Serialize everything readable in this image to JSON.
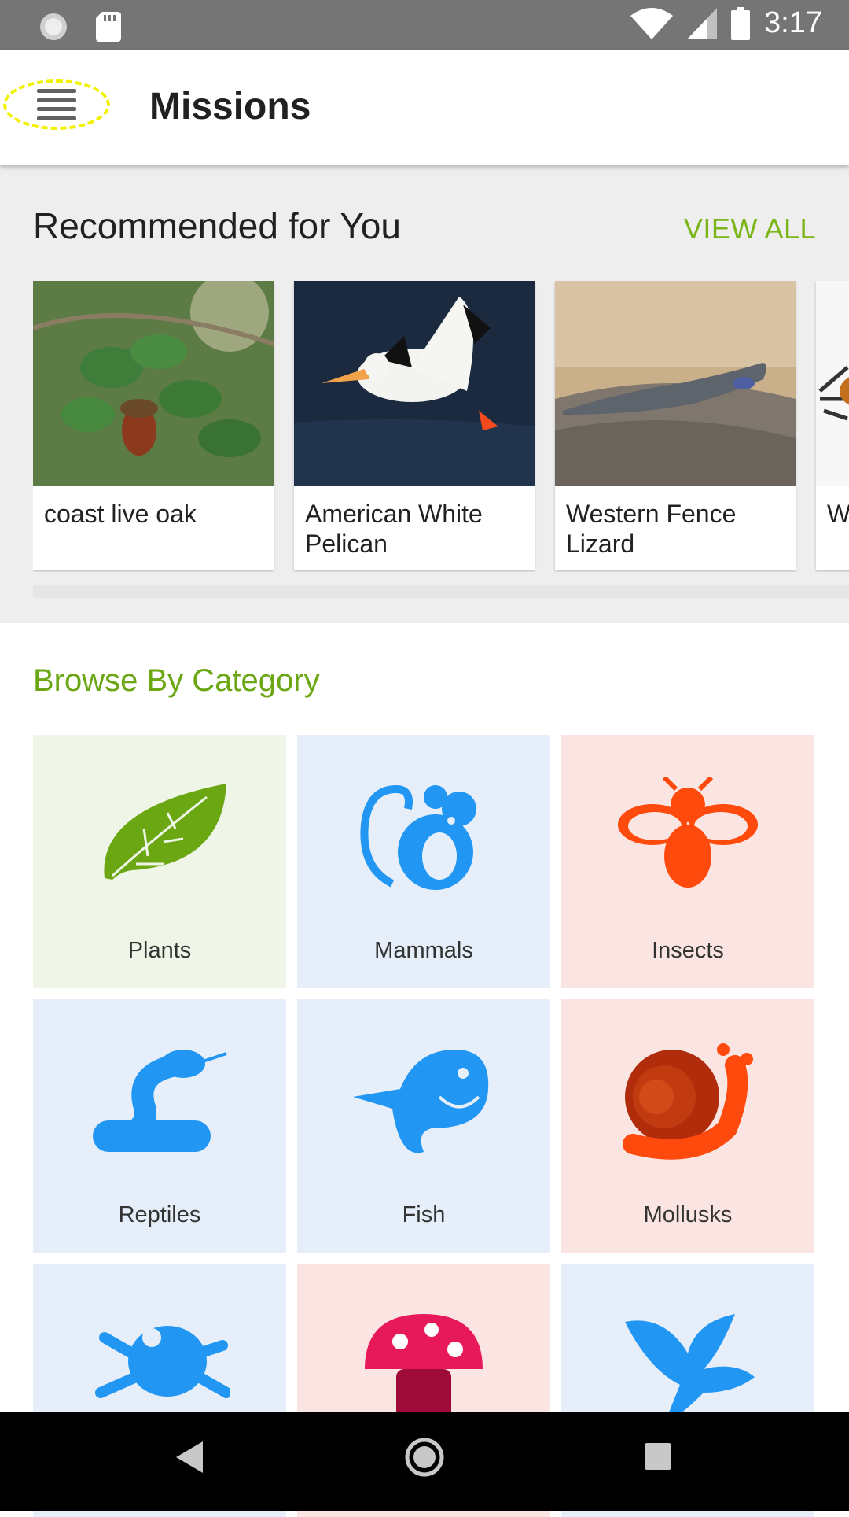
{
  "status_bar": {
    "time": "3:17",
    "icons": [
      "sync-icon",
      "sd-card-icon",
      "wifi-icon",
      "signal-icon",
      "battery-icon"
    ]
  },
  "app_bar": {
    "title": "Missions",
    "menu_icon": "hamburger-menu-icon"
  },
  "recommended": {
    "title": "Recommended for You",
    "view_all": "VIEW ALL",
    "cards": [
      {
        "label": "coast live oak",
        "image": "oak leaves with acorn"
      },
      {
        "label": "American White Pelican",
        "image": "flying pelican over water"
      },
      {
        "label": "Western Fence Lizard",
        "image": "lizard on a log"
      },
      {
        "label": "W",
        "image": "insect"
      }
    ]
  },
  "browse": {
    "title": "Browse By Category",
    "categories": [
      {
        "label": "Plants",
        "icon": "leaf-icon"
      },
      {
        "label": "Mammals",
        "icon": "mouse-icon"
      },
      {
        "label": "Insects",
        "icon": "bee-icon"
      },
      {
        "label": "Reptiles",
        "icon": "snake-icon"
      },
      {
        "label": "Fish",
        "icon": "fish-icon"
      },
      {
        "label": "Mollusks",
        "icon": "snail-icon"
      },
      {
        "label": "",
        "icon": "frog-icon"
      },
      {
        "label": "",
        "icon": "mushroom-icon"
      },
      {
        "label": "",
        "icon": "bird-icon"
      }
    ]
  },
  "colors": {
    "accent_green": "#7cb518",
    "category_blue": "#2196f3",
    "category_orange": "#ff4a0d",
    "status_bar": "#757575"
  }
}
